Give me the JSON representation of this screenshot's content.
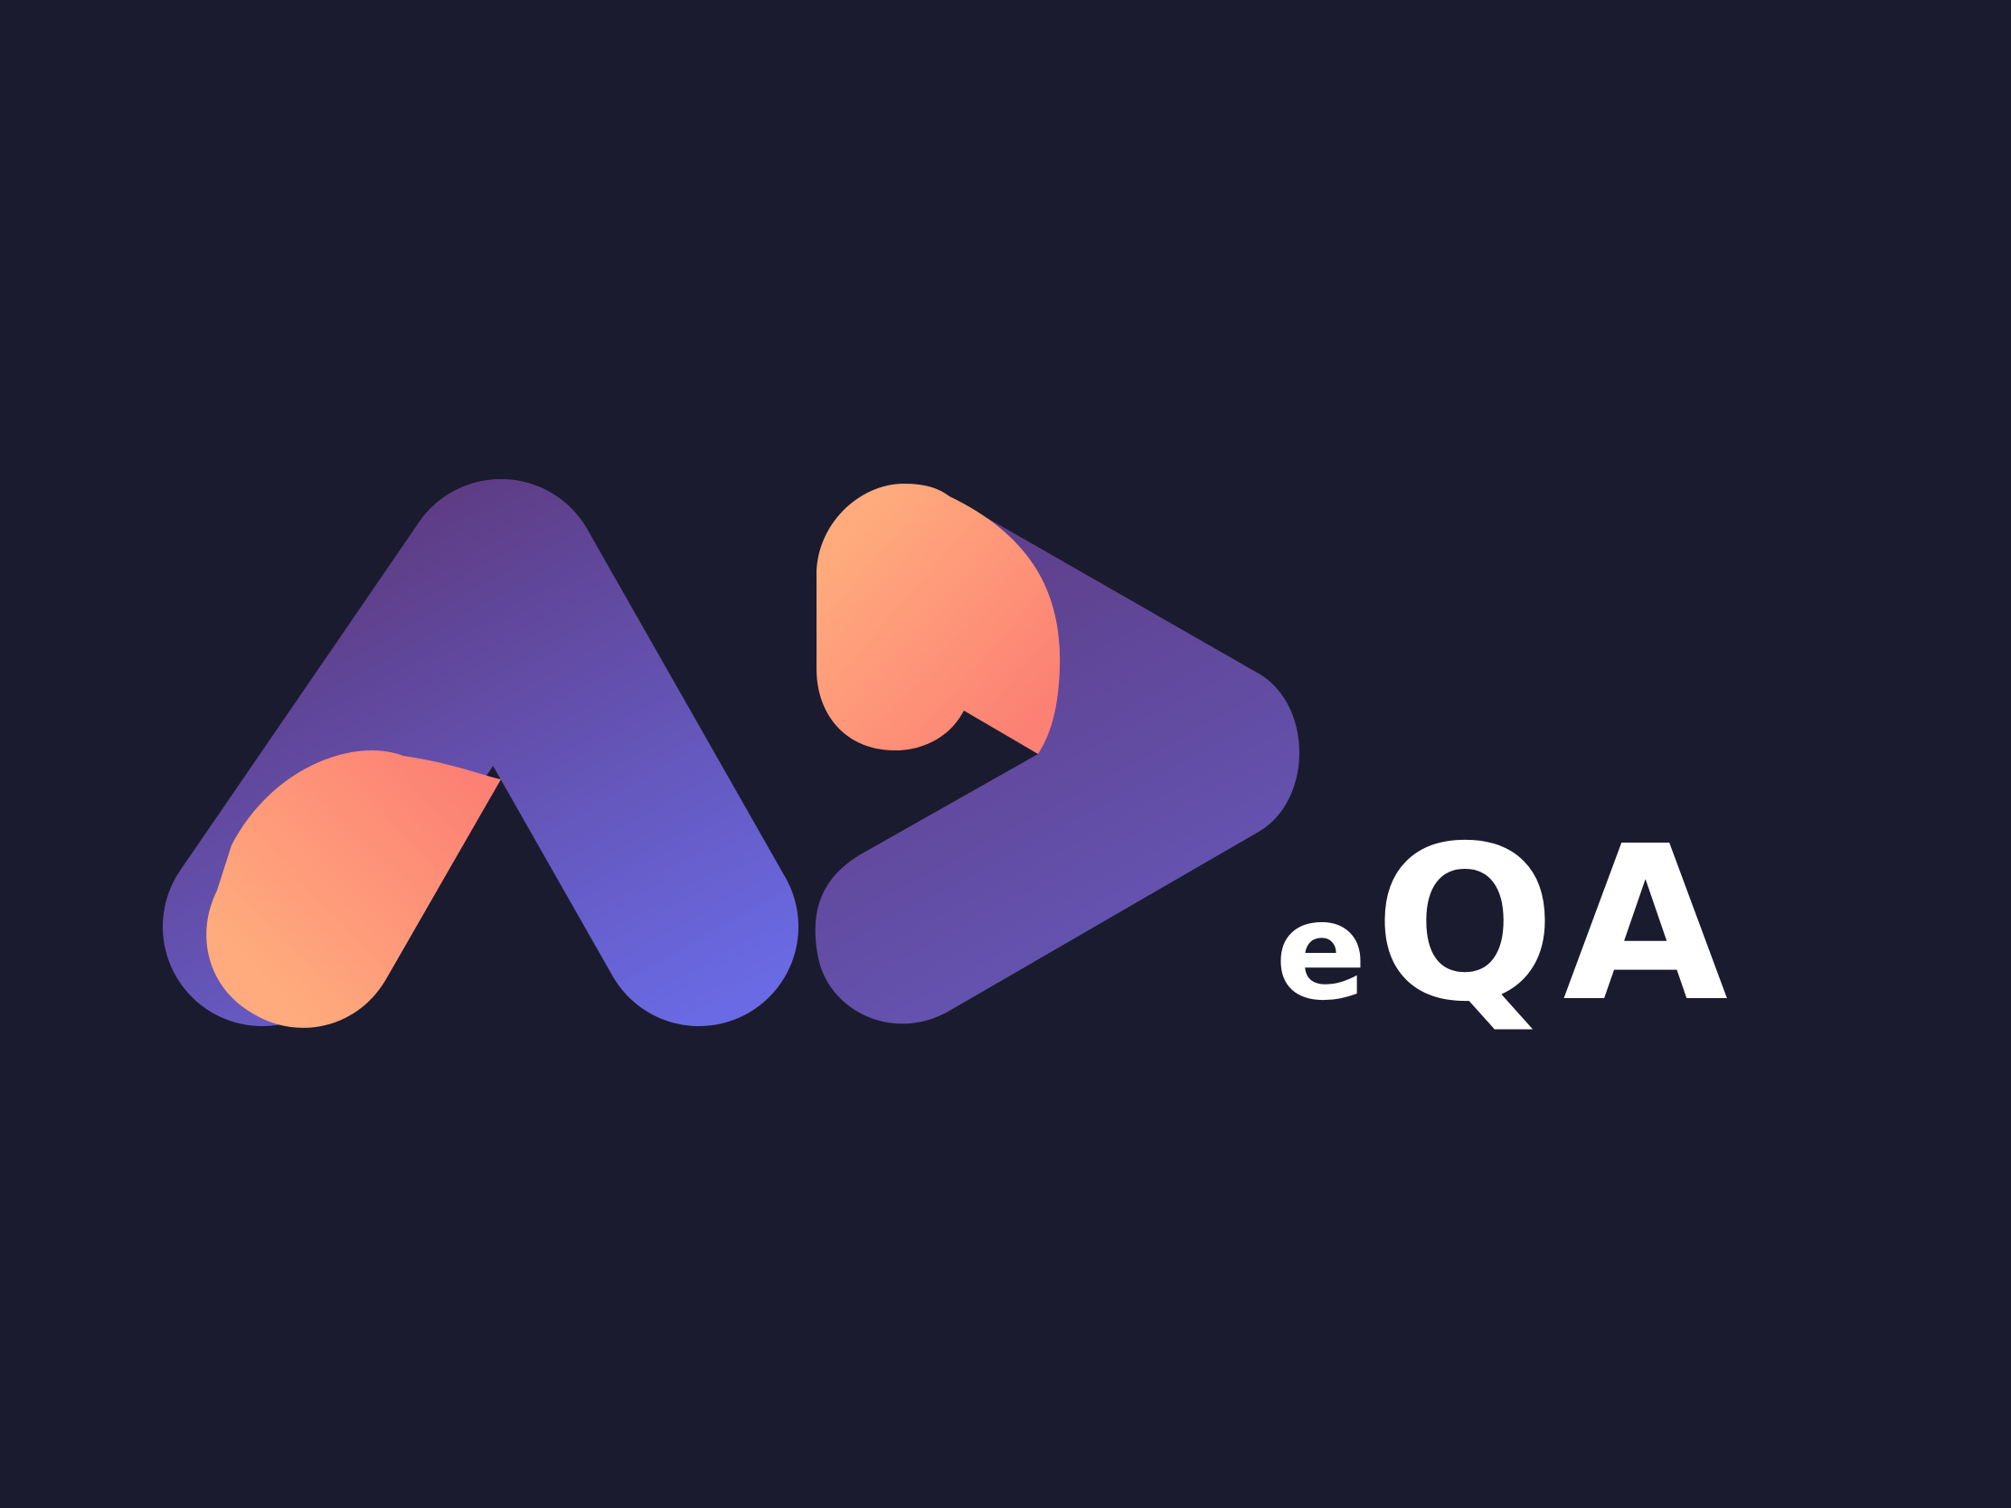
{
  "logo": {
    "icon": "aeqa-logo-mark-icon",
    "wordmark": {
      "small": "e",
      "large": "QA"
    },
    "colors": {
      "background": "#1b1b2f",
      "purple_dark": "#5e3d86",
      "purple_light": "#6a6ae4",
      "orange": "#ffab7d",
      "coral": "#fc8074",
      "text": "#ffffff"
    }
  }
}
